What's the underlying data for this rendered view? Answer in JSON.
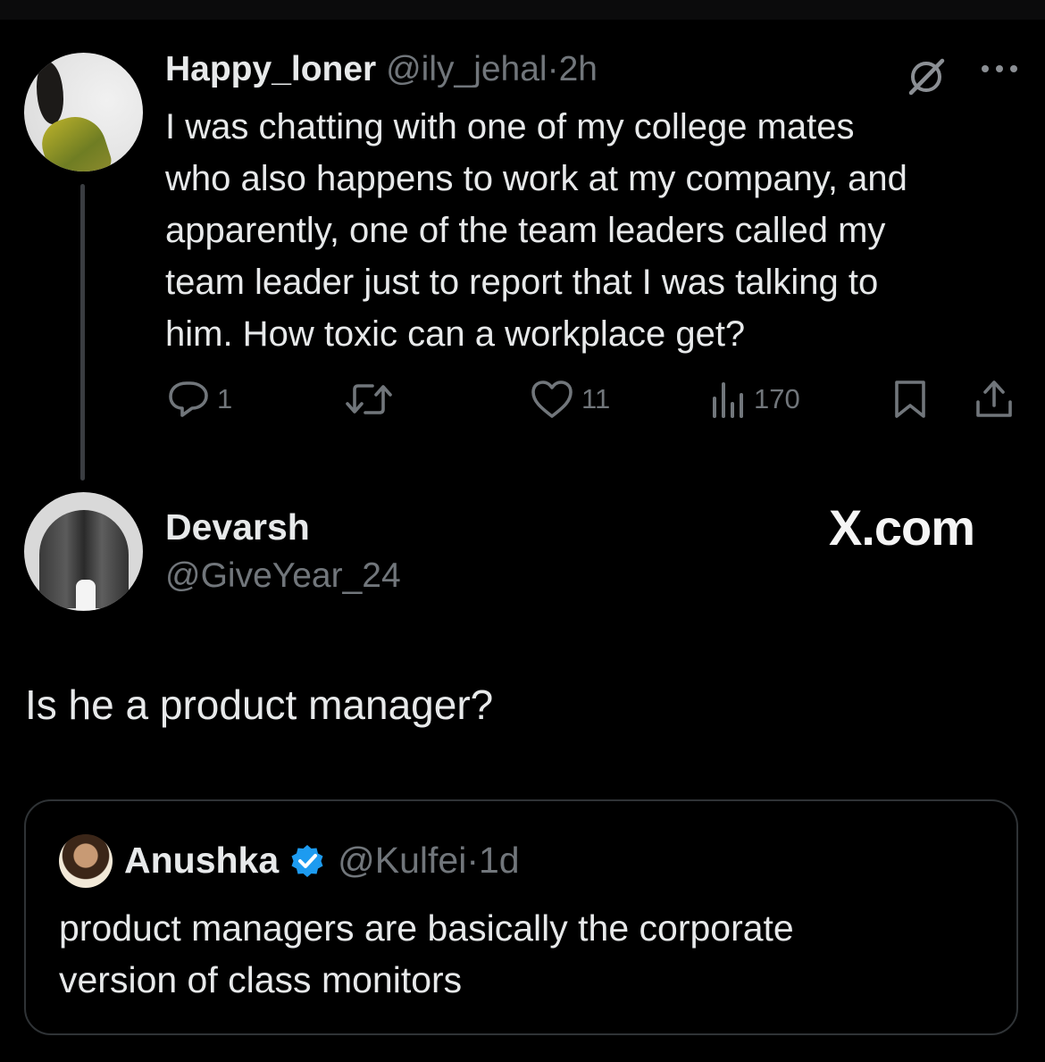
{
  "tweet": {
    "display_name": "Happy_loner",
    "handle": "@ily_jehal",
    "separator": "·",
    "time": "2h",
    "body_lines": [
      "I was chatting with one of my college mates",
      "who also happens to work at my company, and",
      "apparently, one of the team leaders called my",
      "team leader just to report that I was talking to",
      "him. How toxic can a workplace get?"
    ],
    "actions": {
      "replies": "1",
      "retweets": "",
      "likes": "11",
      "views": "170"
    },
    "icons": [
      "grok-icon",
      "more-icon",
      "reply-icon",
      "retweet-icon",
      "like-icon",
      "views-icon",
      "bookmark-icon",
      "share-icon"
    ]
  },
  "reply": {
    "display_name": "Devarsh",
    "handle": "@GiveYear_24",
    "watermark": "X.com",
    "text": "Is he a product manager?"
  },
  "quoted": {
    "display_name": "Anushka",
    "handle": "@Kulfei",
    "separator": "·",
    "time": "1d",
    "verified": true,
    "body_lines": [
      "product managers are basically the corporate",
      "version of class monitors"
    ]
  },
  "colors": {
    "background": "#000000",
    "text": "#e7e9ea",
    "muted": "#71767b",
    "border": "#2f3336",
    "verified": "#1d9bf0"
  }
}
